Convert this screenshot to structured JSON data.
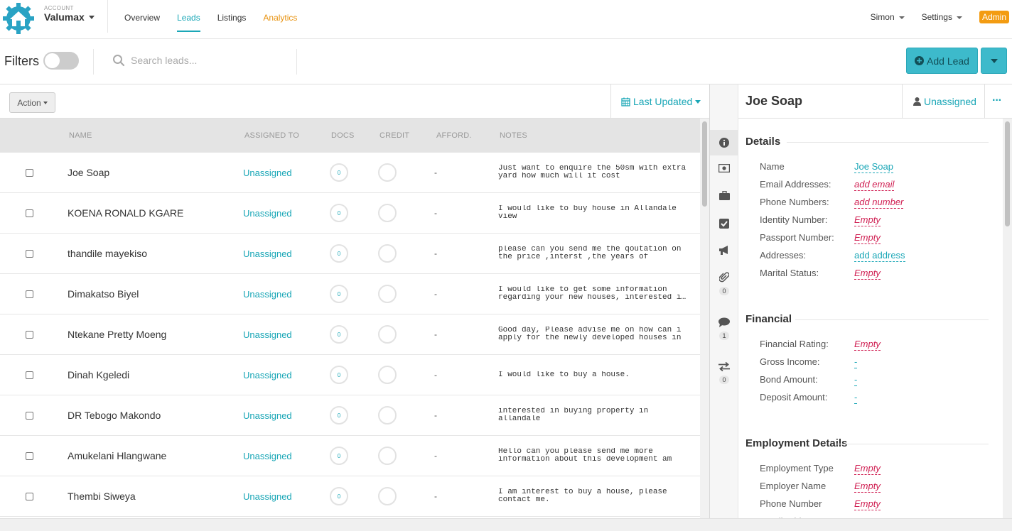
{
  "nav": {
    "account_label": "ACCOUNT",
    "account_name": "Valumax",
    "links": [
      "Overview",
      "Leads",
      "Listings",
      "Analytics"
    ],
    "user": "Simon",
    "settings": "Settings",
    "admin": "Admin"
  },
  "filterbar": {
    "filters_label": "Filters",
    "search_placeholder": "Search leads...",
    "add_lead": "Add Lead"
  },
  "toolbar": {
    "action": "Action",
    "sort": "Last Updated"
  },
  "table": {
    "headers": [
      "NAME",
      "ASSIGNED TO",
      "DOCS",
      "CREDIT",
      "AFFORD.",
      "NOTES"
    ],
    "rows": [
      {
        "name": "Joe Soap",
        "assigned": "Unassigned",
        "docs": "0",
        "afford": "-",
        "notes": [
          "Just want to enquire the 50sm with extra",
          "yard how much will it cost"
        ]
      },
      {
        "name": "KOENA RONALD KGARE",
        "assigned": "Unassigned",
        "docs": "0",
        "afford": "-",
        "notes": [
          "I would like to buy house in Allandale",
          "view"
        ]
      },
      {
        "name": "thandile mayekiso",
        "assigned": "Unassigned",
        "docs": "0",
        "afford": "-",
        "notes": [
          "please can you send me the qoutation on",
          "the price ,interst ,the years of"
        ]
      },
      {
        "name": "Dimakatso Biyel",
        "assigned": "Unassigned",
        "docs": "0",
        "afford": "-",
        "notes": [
          "I would like to get some information",
          "regarding your new houses, interested i…"
        ]
      },
      {
        "name": "Ntekane Pretty Moeng",
        "assigned": "Unassigned",
        "docs": "0",
        "afford": "-",
        "notes": [
          "Good day, Please advise me on how can i",
          "apply for the newly developed houses in"
        ]
      },
      {
        "name": "Dinah Kgeledi",
        "assigned": "Unassigned",
        "docs": "0",
        "afford": "-",
        "notes": [
          "I would like to buy a house.",
          ""
        ]
      },
      {
        "name": "DR Tebogo Makondo",
        "assigned": "Unassigned",
        "docs": "0",
        "afford": "-",
        "notes": [
          "interested in buying property in",
          "allandale"
        ]
      },
      {
        "name": "Amukelani Hlangwane",
        "assigned": "Unassigned",
        "docs": "0",
        "afford": "-",
        "notes": [
          "Hello can you please send me more",
          "information about this development am"
        ]
      },
      {
        "name": "Thembi Siweya",
        "assigned": "Unassigned",
        "docs": "0",
        "afford": "-",
        "notes": [
          "I am interest to buy a house, please",
          "contact me."
        ]
      }
    ]
  },
  "strip": {
    "attachments_count": "0",
    "comments_count": "1",
    "transfers_count": "0"
  },
  "detail": {
    "name": "Joe Soap",
    "assigned": "Unassigned",
    "more": "···",
    "sections": {
      "details": {
        "title": "Details",
        "fields": [
          {
            "label": "Name",
            "value": "Joe Soap"
          },
          {
            "label": "Email Addresses:",
            "value": "add email"
          },
          {
            "label": "Phone Numbers:",
            "value": "add number"
          },
          {
            "label": "Identity Number:",
            "value": "Empty"
          },
          {
            "label": "Passport Number:",
            "value": "Empty"
          },
          {
            "label": "Addresses:",
            "value": "add address"
          },
          {
            "label": "Marital Status:",
            "value": "Empty"
          }
        ]
      },
      "financial": {
        "title": "Financial",
        "fields": [
          {
            "label": "Financial Rating:",
            "value": "Empty"
          },
          {
            "label": "Gross Income:",
            "value": "-"
          },
          {
            "label": "Bond Amount:",
            "value": "-"
          },
          {
            "label": "Deposit Amount:",
            "value": "-"
          }
        ]
      },
      "employment": {
        "title": "Employment Details",
        "fields": [
          {
            "label": "Employment Type",
            "value": "Empty"
          },
          {
            "label": "Employer Name",
            "value": "Empty"
          },
          {
            "label": "Phone Number",
            "value": "Empty"
          },
          {
            "label": "Email Address",
            "value": "Empty"
          }
        ]
      }
    }
  },
  "colors": {
    "accent": "#1ba7b7",
    "analytics": "#e8920e",
    "admin": "#f39c12",
    "empty": "#d02053",
    "button": "#3dbacb"
  }
}
